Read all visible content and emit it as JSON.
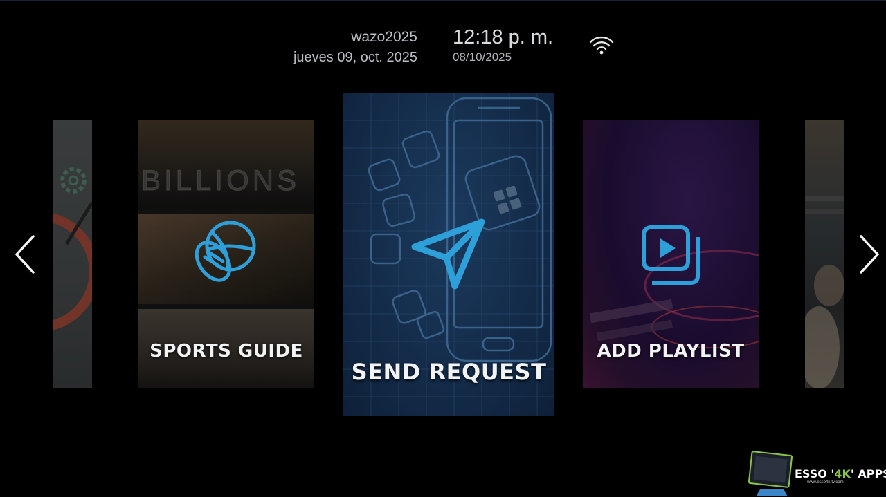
{
  "header": {
    "username": "wazo2025",
    "date_long": "jueves 09, oct. 2025",
    "time": "12:18 p. m.",
    "date_short": "08/10/2025",
    "status_icon": "wifi-icon"
  },
  "nav": {
    "prev_icon": "chevron-left-icon",
    "next_icon": "chevron-right-icon"
  },
  "cards": [
    {
      "id": "settings-partial",
      "label": "",
      "icon": "gear-icon"
    },
    {
      "id": "sports-guide",
      "label": "SPORTS GUIDE",
      "icon": "sports-ball-icon",
      "poster_title": "BILLIONS"
    },
    {
      "id": "send-request",
      "label": "SEND REQUEST",
      "icon": "paper-plane-icon",
      "focused": true
    },
    {
      "id": "add-playlist",
      "label": "ADD PLAYLIST",
      "icon": "playlist-play-icon"
    },
    {
      "id": "next-partial",
      "label": "",
      "icon": ""
    }
  ],
  "colors": {
    "accent": "#2d9fd9",
    "background": "#000000",
    "label": "#f1f3f5"
  },
  "watermark": {
    "brand_prefix": "ESSO '",
    "brand_accent": "4K",
    "brand_suffix": "' APPS",
    "url": "www.esso4k-tv.com"
  }
}
